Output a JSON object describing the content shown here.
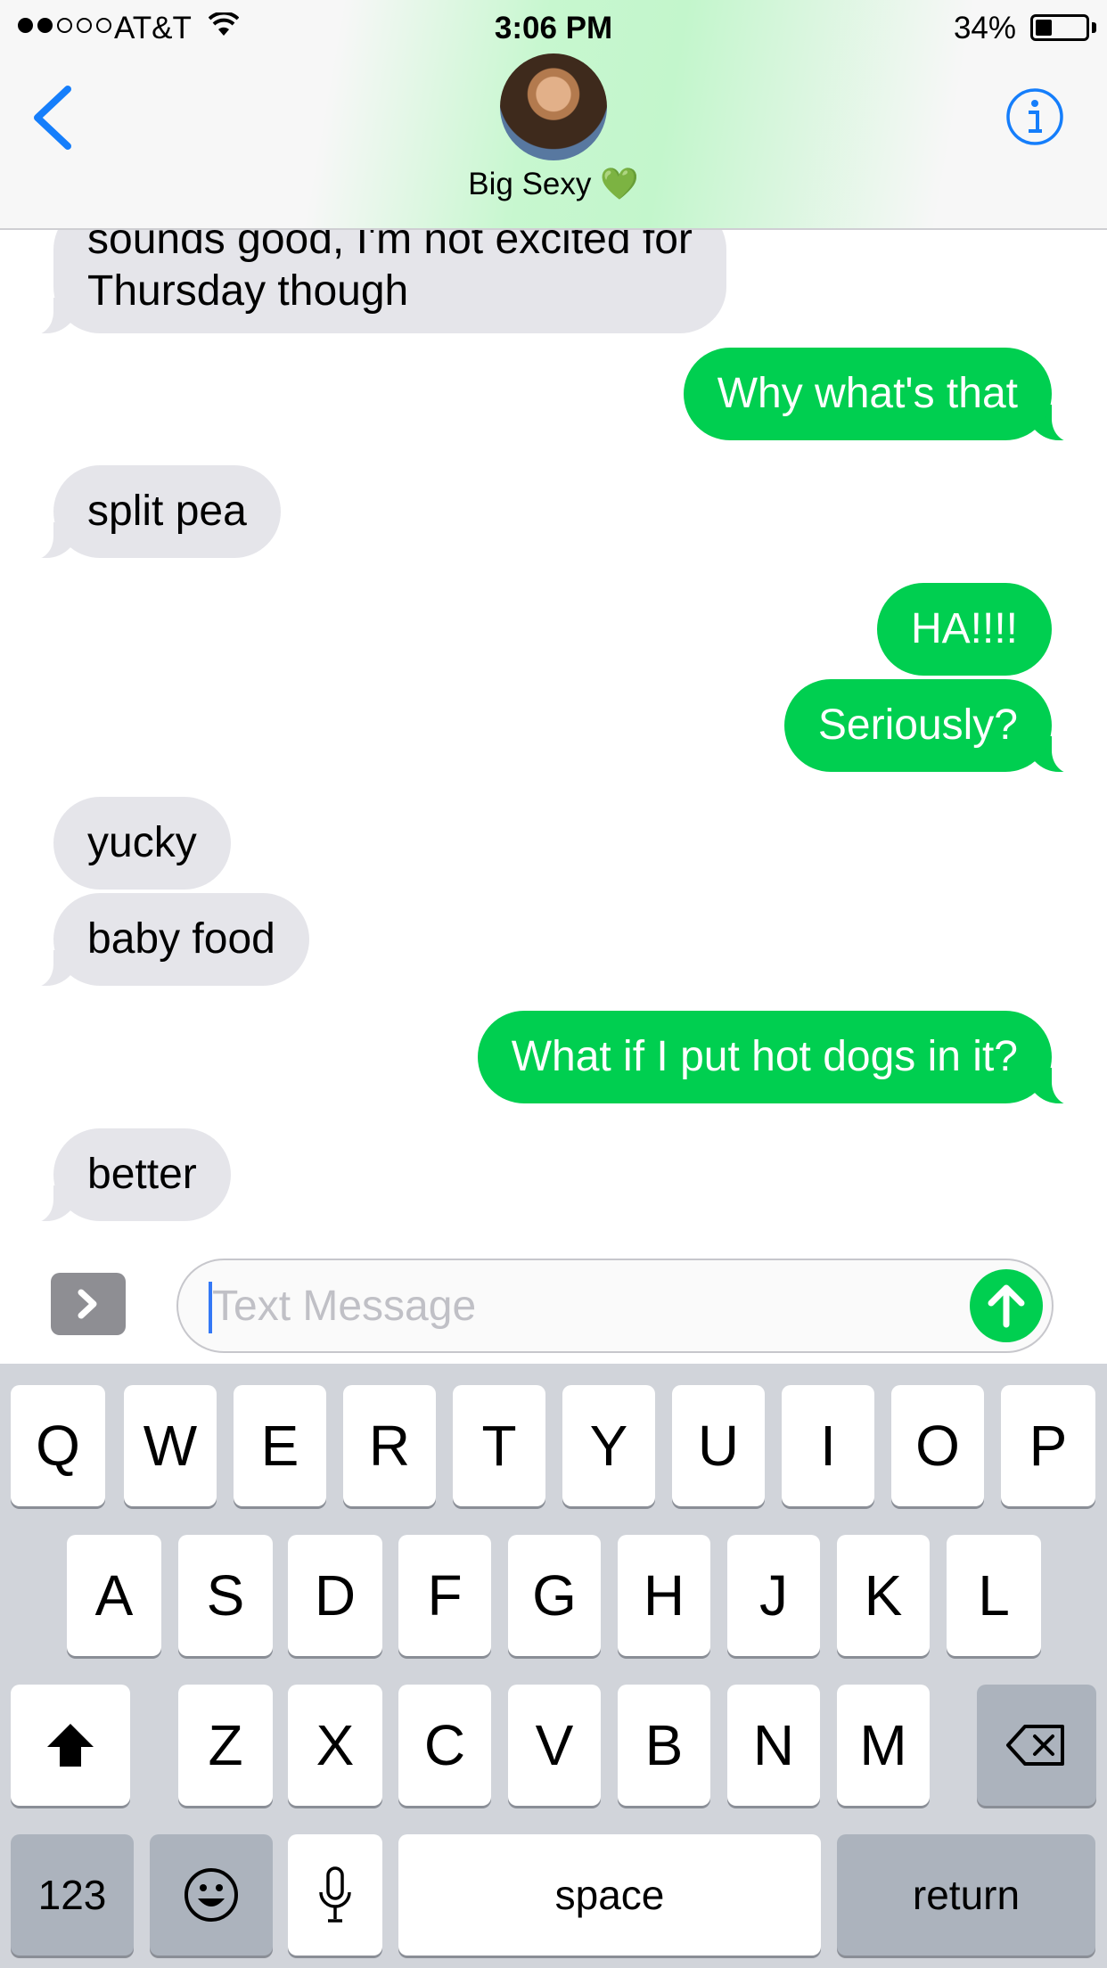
{
  "status_bar": {
    "carrier": "AT&T",
    "time": "3:06 PM",
    "battery_percent": "34%",
    "battery_level": 0.34,
    "signal_bars": 2,
    "signal_total": 5
  },
  "header": {
    "contact_name": "Big Sexy 💚",
    "back_icon": "chevron-left-icon",
    "info_icon": "info-icon",
    "accent_color": "#157efb"
  },
  "messages": [
    {
      "direction": "received",
      "text_cut": "sounds good, I'm not excited for",
      "text": "Thursday though"
    },
    {
      "direction": "sent",
      "text": "Why what's that"
    },
    {
      "direction": "received",
      "text": "split pea"
    },
    {
      "direction": "sent",
      "text": "HA!!!!"
    },
    {
      "direction": "sent",
      "text": "Seriously?"
    },
    {
      "direction": "received",
      "text": "yucky"
    },
    {
      "direction": "received",
      "text": "baby food"
    },
    {
      "direction": "sent",
      "text": "What if I put hot dogs in it?"
    },
    {
      "direction": "received",
      "text": "better"
    }
  ],
  "input": {
    "placeholder": "Text Message",
    "value": "",
    "send_icon": "arrow-up-icon",
    "apps_icon": "chevron-right-icon"
  },
  "colors": {
    "sent_bubble": "#00cf50",
    "received_bubble": "#e5e5ea"
  },
  "keyboard": {
    "row1": [
      "Q",
      "W",
      "E",
      "R",
      "T",
      "Y",
      "U",
      "I",
      "O",
      "P"
    ],
    "row2": [
      "A",
      "S",
      "D",
      "F",
      "G",
      "H",
      "J",
      "K",
      "L"
    ],
    "row3": [
      "Z",
      "X",
      "C",
      "V",
      "B",
      "N",
      "M"
    ],
    "shift_icon": "shift-icon",
    "delete_icon": "backspace-icon",
    "numbers_label": "123",
    "emoji_icon": "emoji-icon",
    "mic_icon": "microphone-icon",
    "space_label": "space",
    "return_label": "return"
  }
}
